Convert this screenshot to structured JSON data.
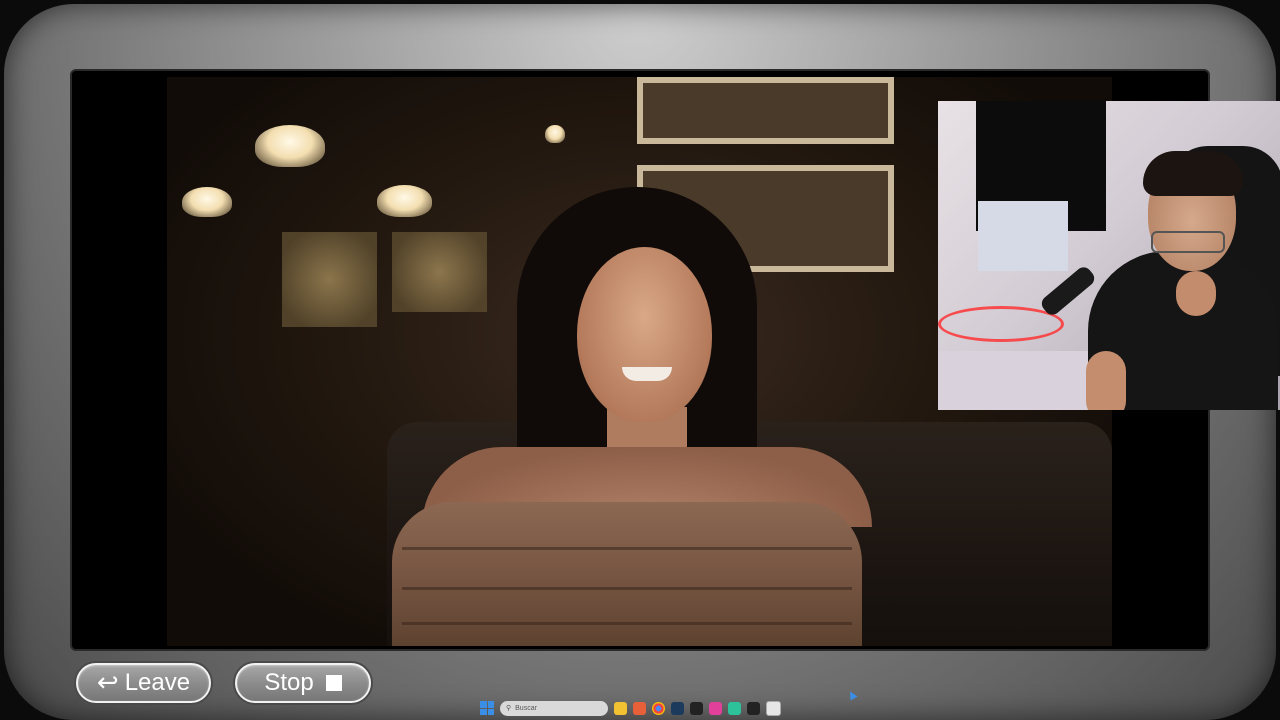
{
  "controls": {
    "leave_label": "Leave",
    "leave_icon": "return-arrow-icon",
    "stop_label": "Stop",
    "stop_icon": "stop-square-icon"
  },
  "taskbar": {
    "search_placeholder": "Buscar",
    "icons": [
      "windows-start-icon",
      "file-explorer-icon",
      "app-orange-icon",
      "chrome-icon",
      "steam-icon",
      "app-m-icon",
      "app-pink-icon",
      "app-green-icon",
      "app-m2-icon",
      "app-white-icon"
    ]
  },
  "colors": {
    "bezel": "#9d9d9d",
    "button_fill": "#8c8c8c",
    "button_border": "#f2f2f2",
    "taskbar_accent": "#3a8ee6"
  }
}
